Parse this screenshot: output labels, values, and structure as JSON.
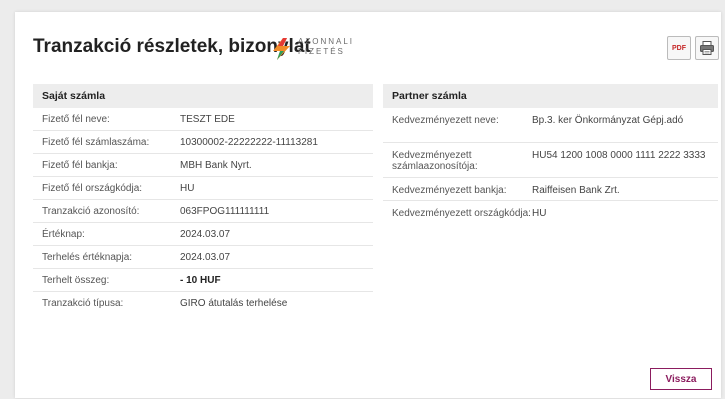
{
  "header": {
    "title": "Tranzakció részletek, bizonylat",
    "logo_line1": "AZONNALI",
    "logo_line2": "FIZETÉS",
    "pdf_label": "PDF"
  },
  "own_account": {
    "heading": "Saját számla",
    "rows": [
      {
        "label": "Fizető fél neve:",
        "value": "TESZT EDE"
      },
      {
        "label": "Fizető fél számlaszáma:",
        "value": "10300002-22222222-11113281"
      },
      {
        "label": "Fizető fél bankja:",
        "value": "MBH Bank Nyrt."
      },
      {
        "label": "Fizető fél országkódja:",
        "value": "HU"
      },
      {
        "label": "Tranzakció azonosító:",
        "value": "063FPOG111111111"
      },
      {
        "label": "Értéknap:",
        "value": "2024.03.07"
      },
      {
        "label": "Terhelés értéknapja:",
        "value": "2024.03.07"
      },
      {
        "label": "Terhelt összeg:",
        "value": "- 10 HUF"
      },
      {
        "label": "Tranzakció típusa:",
        "value": "GIRO átutalás terhelése"
      }
    ]
  },
  "partner_account": {
    "heading": "Partner számla",
    "rows": [
      {
        "label": "Kedvezményezett neve:",
        "value": "Bp.3. ker Önkormányzat Gépj.adó"
      },
      {
        "label": "Kedvezményezett számlaazonosítója:",
        "value": "HU54 1200 1008 0000 1111 2222 3333"
      },
      {
        "label": "Kedvezményezett bankja:",
        "value": "Raiffeisen Bank Zrt."
      },
      {
        "label": "Kedvezményezett országkódja:",
        "value": "HU"
      }
    ]
  },
  "actions": {
    "back_label": "Vissza"
  },
  "colors": {
    "accent": "#8b1c5e",
    "logo_orange": "#f28c28",
    "logo_green": "#2e9e5b",
    "panel_header": "#ededed"
  }
}
